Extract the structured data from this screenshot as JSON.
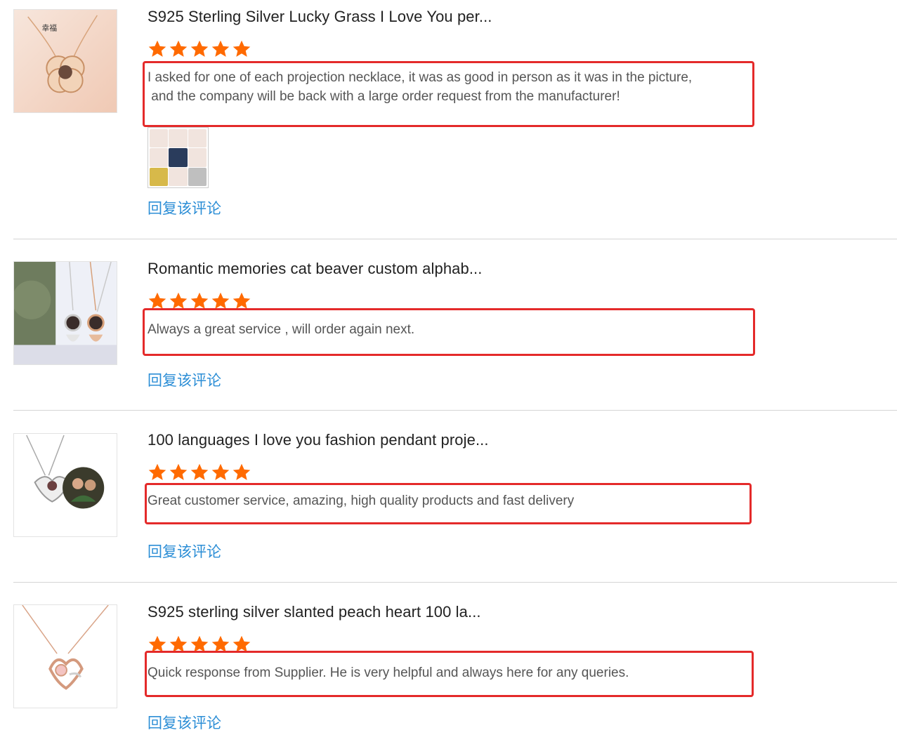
{
  "reviews": [
    {
      "title": "S925 Sterling Silver Lucky Grass I Love You per...",
      "rating": 5,
      "comment": "I asked for one of each projection necklace, it was as good in person as it was in the picture,\n and the company will be back with a large order request from the manufacturer!",
      "reply_label": "回复该评论",
      "thumb_icon": "flower-pendant-necklace-photo",
      "thumb_caption": "幸福"
    },
    {
      "title": "Romantic memories cat beaver custom alphab...",
      "rating": 5,
      "comment": "Always a great service , will order again next.",
      "reply_label": "回复该评论",
      "thumb_icon": "owl-pendant-necklaces-photo"
    },
    {
      "title": "100 languages I love you fashion pendant proje...",
      "rating": 5,
      "comment": "Great customer service, amazing, high quality products and fast delivery",
      "reply_label": "回复该评论",
      "thumb_icon": "heart-projection-pendant-photo"
    },
    {
      "title": "S925 sterling silver slanted peach heart 100 la...",
      "rating": 5,
      "comment": "Quick response from Supplier. He is very helpful and always here for any queries.",
      "reply_label": "回复该评论",
      "thumb_icon": "rose-gold-heart-pendant-photo"
    }
  ],
  "colors": {
    "star": "#ff6a00",
    "highlight_box": "#e42a2a",
    "link": "#2c8ed6",
    "divider": "#d5d5d5"
  }
}
